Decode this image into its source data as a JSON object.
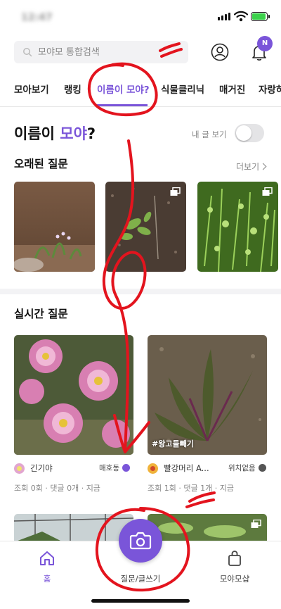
{
  "status_bar": {
    "time": "12:47"
  },
  "header": {
    "search_placeholder": "모야모 통합검색",
    "notification_badge": "N"
  },
  "tabs": [
    {
      "label": "모아보기",
      "active": false
    },
    {
      "label": "랭킹",
      "active": false
    },
    {
      "label": "이름이 모야?",
      "active": true
    },
    {
      "label": "식물클리닉",
      "active": false
    },
    {
      "label": "매거진",
      "active": false
    },
    {
      "label": "자랑하기",
      "active": false
    }
  ],
  "page": {
    "title_prefix": "이름이 ",
    "title_accent": "모야",
    "title_suffix": "?",
    "my_posts_label": "내 글 보기",
    "my_posts_toggle": false
  },
  "old_questions": {
    "title": "오래된 질문",
    "more_label": "더보기"
  },
  "live_questions": {
    "title": "실시간 질문",
    "cards": [
      {
        "user": "긴기야",
        "location": "매호동",
        "stats": "조회 0회 · 댓글 0개 · 지금"
      },
      {
        "tag": "#왕고들빼기",
        "user": "빨강머리 A...",
        "location": "위치없음",
        "stats": "조회 1회 · 댓글 1개 · 지금"
      }
    ]
  },
  "bottom_nav": {
    "home_label": "홈",
    "write_label": "질문/글쓰기",
    "shop_label": "모야모샵"
  },
  "colors": {
    "accent": "#7a55d9",
    "annotation": "#e3141e"
  }
}
